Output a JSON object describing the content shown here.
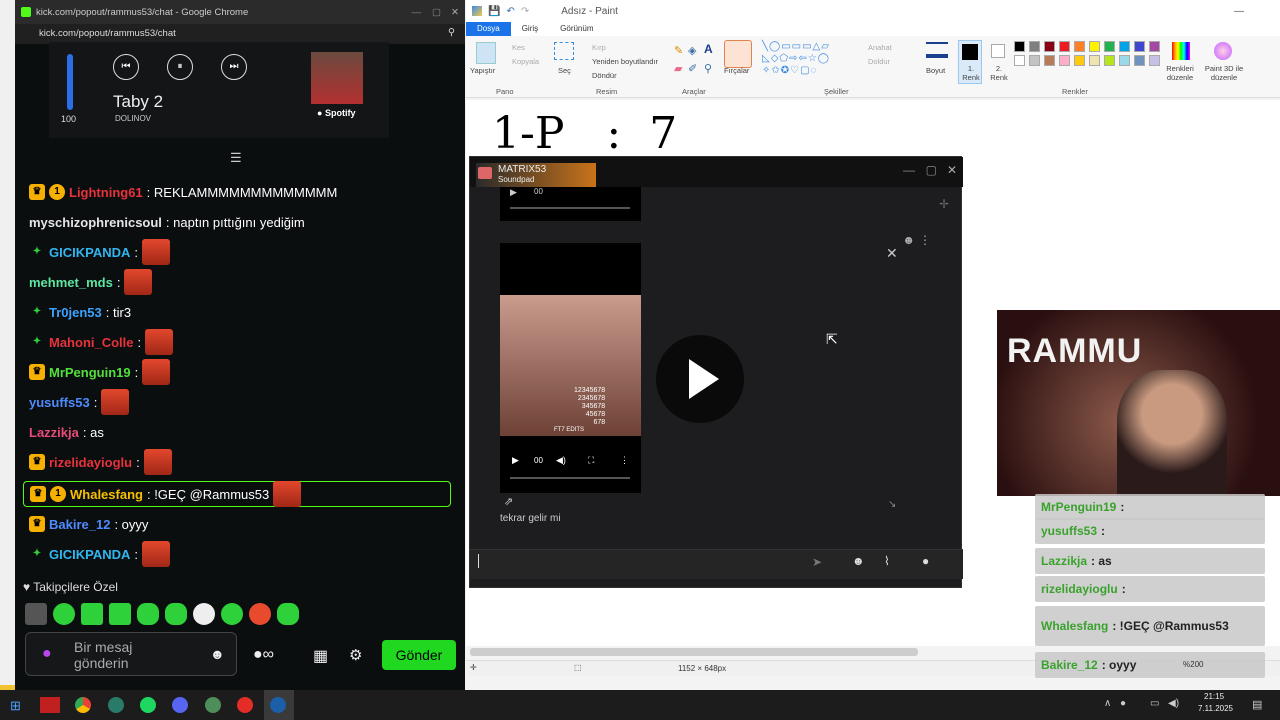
{
  "paint": {
    "title": "Adsız - Paint",
    "tabs": [
      "Dosya",
      "Giriş",
      "Görünüm"
    ],
    "ribbon": {
      "groups": [
        "Pano",
        "Resim",
        "Araçlar",
        "Şekiller",
        "Renkler"
      ],
      "clipboard": {
        "paste": "Yapıştır",
        "cut": "Kes",
        "copy": "Kopyala"
      },
      "image": {
        "select": "Seç",
        "crop": "Kırp",
        "resize": "Yeniden boyutlandır",
        "rotate": "Döndür"
      },
      "brushes": "Fırçalar",
      "shapes": {
        "outline": "Anahat",
        "fill": "Doldur"
      },
      "size": "Boyut",
      "color1": "1. Renk",
      "color2": "2. Renk",
      "edit_colors": "Renkleri düzenle",
      "paint3d": "Paint 3D ile düzenle",
      "palette": [
        "#000000",
        "#7f7f7f",
        "#880015",
        "#ed1c24",
        "#ff7f27",
        "#fff200",
        "#22b14c",
        "#00a2e8",
        "#3f48cc",
        "#a349a4",
        "#ffffff",
        "#c3c3c3",
        "#b97a57",
        "#ffaec9",
        "#ffc90e",
        "#efe4b0",
        "#b5e61d",
        "#99d9ea",
        "#7092be",
        "#c8bfe7"
      ]
    },
    "canvas_text": "1-P   :  7",
    "status": {
      "dimensions": "1152 × 648px",
      "zoom": "%200"
    }
  },
  "chat": {
    "window_title": "kick.com/popout/rammus53/chat - Google Chrome",
    "url": "kick.com/popout/rammus53/chat",
    "spotify": {
      "volume": "100",
      "track": "Tabу 2",
      "artist": "DOLINOV",
      "brand": "Spotify"
    },
    "messages": [
      {
        "user": "Lightning61",
        "color": "#e8323c",
        "text": ": REKLAMMMMMMMMMMMMM"
      },
      {
        "user": "myschizophrenicsoul",
        "color": "#e6e6e6",
        "text": ": naptın pıttığını yediğim"
      },
      {
        "user": "GICIKPANDA",
        "color": "#32b6f0",
        "text": ":"
      },
      {
        "user": "mehmet_mds",
        "color": "#5ce6a0",
        "text": ":"
      },
      {
        "user": "Tr0jen53",
        "color": "#3aa2ff",
        "text": ": tir3"
      },
      {
        "user": "Mahoni_Colle",
        "color": "#e8323c",
        "text": ":"
      },
      {
        "user": "MrPenguin19",
        "color": "#53e03c",
        "text": ":"
      },
      {
        "user": "yusuffs53",
        "color": "#4d8bff",
        "text": ":"
      },
      {
        "user": "Lazzikja",
        "color": "#e84a7a",
        "text": ": as"
      },
      {
        "user": "rizelidayioglu",
        "color": "#e8323c",
        "text": ":"
      },
      {
        "user": "Whalesfang",
        "color": "#f6c000",
        "text": ": !GEÇ @Rammus53"
      },
      {
        "user": "Bakire_12",
        "color": "#4d8bff",
        "text": ": oyyy"
      },
      {
        "user": "GICIKPANDA",
        "color": "#32b6f0",
        "text": ":"
      }
    ],
    "followers_only": "Takipçilere Özel",
    "input_placeholder": "Bir mesaj gönderin",
    "send_label": "Gönder"
  },
  "soundpad": {
    "title": "MATRIX53",
    "subtitle": "Soundpad",
    "video_time": "00",
    "overlay_numbers": "12345678\n2345678\n345678\n45678\n678",
    "edits_label": "FT7 EDITS",
    "caption": "tekrar gelir mi"
  },
  "cam": {
    "brand": "RAMMU"
  },
  "overlay_chat": [
    {
      "user": "MrPenguin19",
      "text": ":"
    },
    {
      "user": "yusuffs53",
      "text": ":"
    },
    {
      "user": "Lazzikja",
      "text": ": as"
    },
    {
      "user": "rizelidayioglu",
      "text": ":"
    },
    {
      "user": "Whalesfang",
      "text": ": !GEÇ @Rammus53"
    },
    {
      "user": "Bakire_12",
      "text": ": oyyy"
    }
  ],
  "taskbar": {
    "time": "21:15",
    "date": "7.11.2025"
  }
}
